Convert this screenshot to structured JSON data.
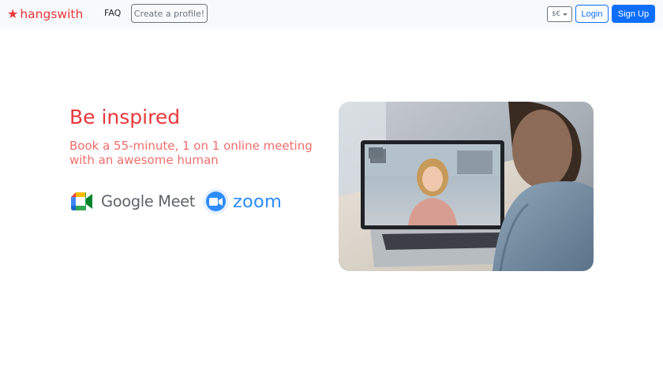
{
  "navbar": {
    "brand": "hangswith",
    "faq_label": "FAQ",
    "create_profile_label": "Create a profile!",
    "currency_label": "$€",
    "login_label": "Login",
    "signup_label": "Sign Up"
  },
  "hero": {
    "title": "Be inspired",
    "subtitle": "Book a 55-minute, 1 on 1 online meeting with an awesome human",
    "logos": {
      "google_meet": "Google Meet",
      "zoom": "zoom"
    }
  },
  "colors": {
    "brand": "#e8383c",
    "primary": "#0d6efd",
    "zoom_blue": "#2d8cff"
  }
}
